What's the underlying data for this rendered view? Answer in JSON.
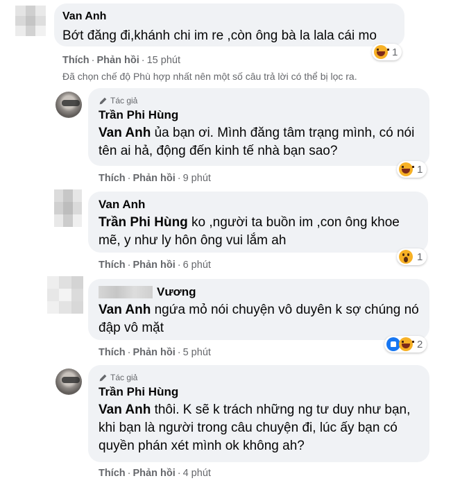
{
  "filter_note": "Đã chọn chế độ Phù hợp nhất nên một số câu trả lời có thể bị lọc ra.",
  "labels": {
    "like": "Thích",
    "reply": "Phản hồi",
    "separator": "·",
    "author_badge": "Tác giả"
  },
  "comments": [
    {
      "author": "Van Anh",
      "mention": "",
      "text": "Bớt đăng đi,khánh chi im re ,còn ông bà la lala cái mo",
      "time": "15 phút",
      "reactions": [
        "haha"
      ],
      "reaction_count": "1"
    },
    {
      "author": "Trần Phi Hùng",
      "is_author": true,
      "mention": "Van Anh",
      "text": " ủa bạn ơi. Mình đăng tâm trạng mình, có nói tên ai hả, động đến kinh tế nhà bạn sao?",
      "time": "9 phút",
      "reactions": [
        "haha"
      ],
      "reaction_count": "1"
    },
    {
      "author": "Van Anh",
      "mention": "Trần Phi Hùng",
      "text": " ko ,người ta buồn im ,con ông khoe mẽ, y như ly hôn ông vui lắm ah",
      "time": "6 phút",
      "reactions": [
        "wow"
      ],
      "reaction_count": "1"
    },
    {
      "author": "Vương",
      "mention": "Van Anh",
      "text": " ngứa mỏ nói chuyện vô duyên k sợ chúng nó đập vô mặt",
      "time": "5 phút",
      "reactions": [
        "like",
        "haha"
      ],
      "reaction_count": "2"
    },
    {
      "author": "Trần Phi Hùng",
      "is_author": true,
      "mention": "Van Anh",
      "text": " thôi. K sẽ k trách những ng tư duy như bạn, khi bạn là người trong câu chuyện đi, lúc ấy bạn có quyền phán xét mình ok không ah?",
      "time": "4 phút",
      "reactions": [],
      "reaction_count": ""
    }
  ]
}
